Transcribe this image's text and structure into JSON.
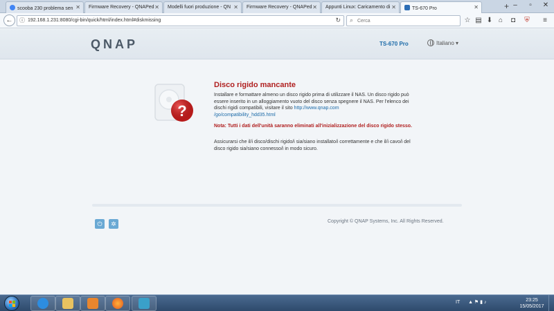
{
  "browser": {
    "tabs": [
      {
        "label": "scooba 230 problema sen",
        "favicon": "google-icon",
        "color": "#4285f4"
      },
      {
        "label": "Firmware Recovery - QNAPed",
        "favicon": "page-icon",
        "color": "#9aa6b3"
      },
      {
        "label": "Modelli fuori produzione - QN",
        "favicon": "page-icon",
        "color": "#9aa6b3"
      },
      {
        "label": "Firmware Recovery - QNAPed",
        "favicon": "page-icon",
        "color": "#9aa6b3"
      },
      {
        "label": "Appunti Linux: Caricamento di",
        "favicon": "page-icon",
        "color": "#9aa6b3"
      },
      {
        "label": "TS-670 Pro",
        "favicon": "qnap-icon",
        "color": "#2c6db5"
      }
    ],
    "url": "192.168.1.231:8080/cgi-bin/quick/html/index.html#diskmissing",
    "search_placeholder": "Cerca"
  },
  "header": {
    "logo": "QNAP",
    "model": "TS-670 Pro",
    "language": "Italiano"
  },
  "content": {
    "title": "Disco rigido mancante",
    "para1": "Installare e formattare almeno un disco rigido prima di utilizzare il NAS. Un disco rigido può essere inserito in un alloggiamento vuoto del disco senza spegnere il NAS. Per l'elenco dei dischi rigidi compatibili, visitare il sito",
    "link": "http://www.qnap.com/go/compatibility_hdd35.html",
    "link_line1": "http://www.qnap.com",
    "link_line2": "/go/compatibility_hdd35.html",
    "warning": "Nota: Tutti i dati dell'unità saranno eliminati all'inizializzazione del disco rigido stesso.",
    "para3": "Assicurarsi che il/i disco/dischi rigido/i sia/siano installato/i correttamente e che il/i cavo/i del disco rigido sia/siano connesso/i in modo sicuro."
  },
  "footer": {
    "copyright": "Copyright © QNAP Systems, Inc. All Rights Reserved."
  },
  "taskbar": {
    "lang": "IT",
    "time": "23:25",
    "date": "15/05/2017"
  }
}
